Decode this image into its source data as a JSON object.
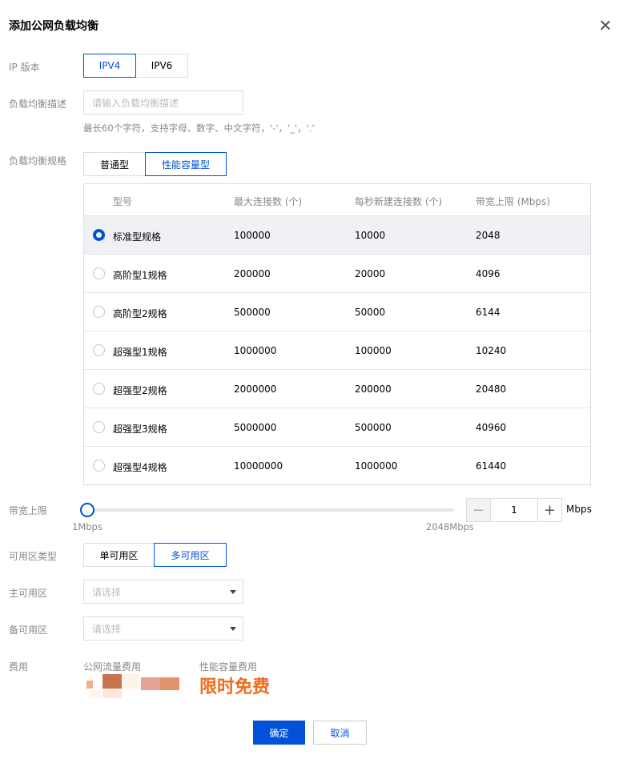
{
  "dialog": {
    "title": "添加公网负载均衡"
  },
  "ip_version": {
    "label": "IP 版本",
    "options": [
      "IPV4",
      "IPV6"
    ],
    "selected": "IPV4"
  },
  "description": {
    "label": "负载均衡描述",
    "placeholder": "请输入负载均衡描述",
    "hint": "最长60个字符，支持字母、数字、中文字符，'-'，'_'，'.'"
  },
  "spec": {
    "label": "负载均衡规格",
    "options": [
      "普通型",
      "性能容量型"
    ],
    "selected": "性能容量型",
    "columns": [
      "型号",
      "最大连接数 (个)",
      "每秒新建连接数 (个)",
      "带宽上限 (Mbps)"
    ],
    "rows": [
      {
        "name": "标准型规格",
        "max_conn": "100000",
        "new_conn": "10000",
        "bandwidth": "2048",
        "selected": true
      },
      {
        "name": "高阶型1规格",
        "max_conn": "200000",
        "new_conn": "20000",
        "bandwidth": "4096",
        "selected": false
      },
      {
        "name": "高阶型2规格",
        "max_conn": "500000",
        "new_conn": "50000",
        "bandwidth": "6144",
        "selected": false
      },
      {
        "name": "超强型1规格",
        "max_conn": "1000000",
        "new_conn": "100000",
        "bandwidth": "10240",
        "selected": false
      },
      {
        "name": "超强型2规格",
        "max_conn": "2000000",
        "new_conn": "200000",
        "bandwidth": "20480",
        "selected": false
      },
      {
        "name": "超强型3规格",
        "max_conn": "5000000",
        "new_conn": "500000",
        "bandwidth": "40960",
        "selected": false
      },
      {
        "name": "超强型4规格",
        "max_conn": "10000000",
        "new_conn": "1000000",
        "bandwidth": "61440",
        "selected": false
      }
    ]
  },
  "bandwidth": {
    "label": "带宽上限",
    "min_label": "1Mbps",
    "max_label": "2048Mbps",
    "value": "1",
    "unit": "Mbps",
    "minus": "−",
    "plus": "+"
  },
  "az_type": {
    "label": "可用区类型",
    "options": [
      "单可用区",
      "多可用区"
    ],
    "selected": "多可用区"
  },
  "primary_az": {
    "label": "主可用区",
    "placeholder": "请选择"
  },
  "backup_az": {
    "label": "备可用区",
    "placeholder": "请选择"
  },
  "fee": {
    "label": "费用",
    "traffic_label": "公网流量费用",
    "capacity_label": "性能容量费用",
    "capacity_value": "限时免费"
  },
  "actions": {
    "confirm": "确定",
    "cancel": "取消"
  },
  "colors": {
    "accent": "#0052d9",
    "free": "#f26a1b"
  }
}
